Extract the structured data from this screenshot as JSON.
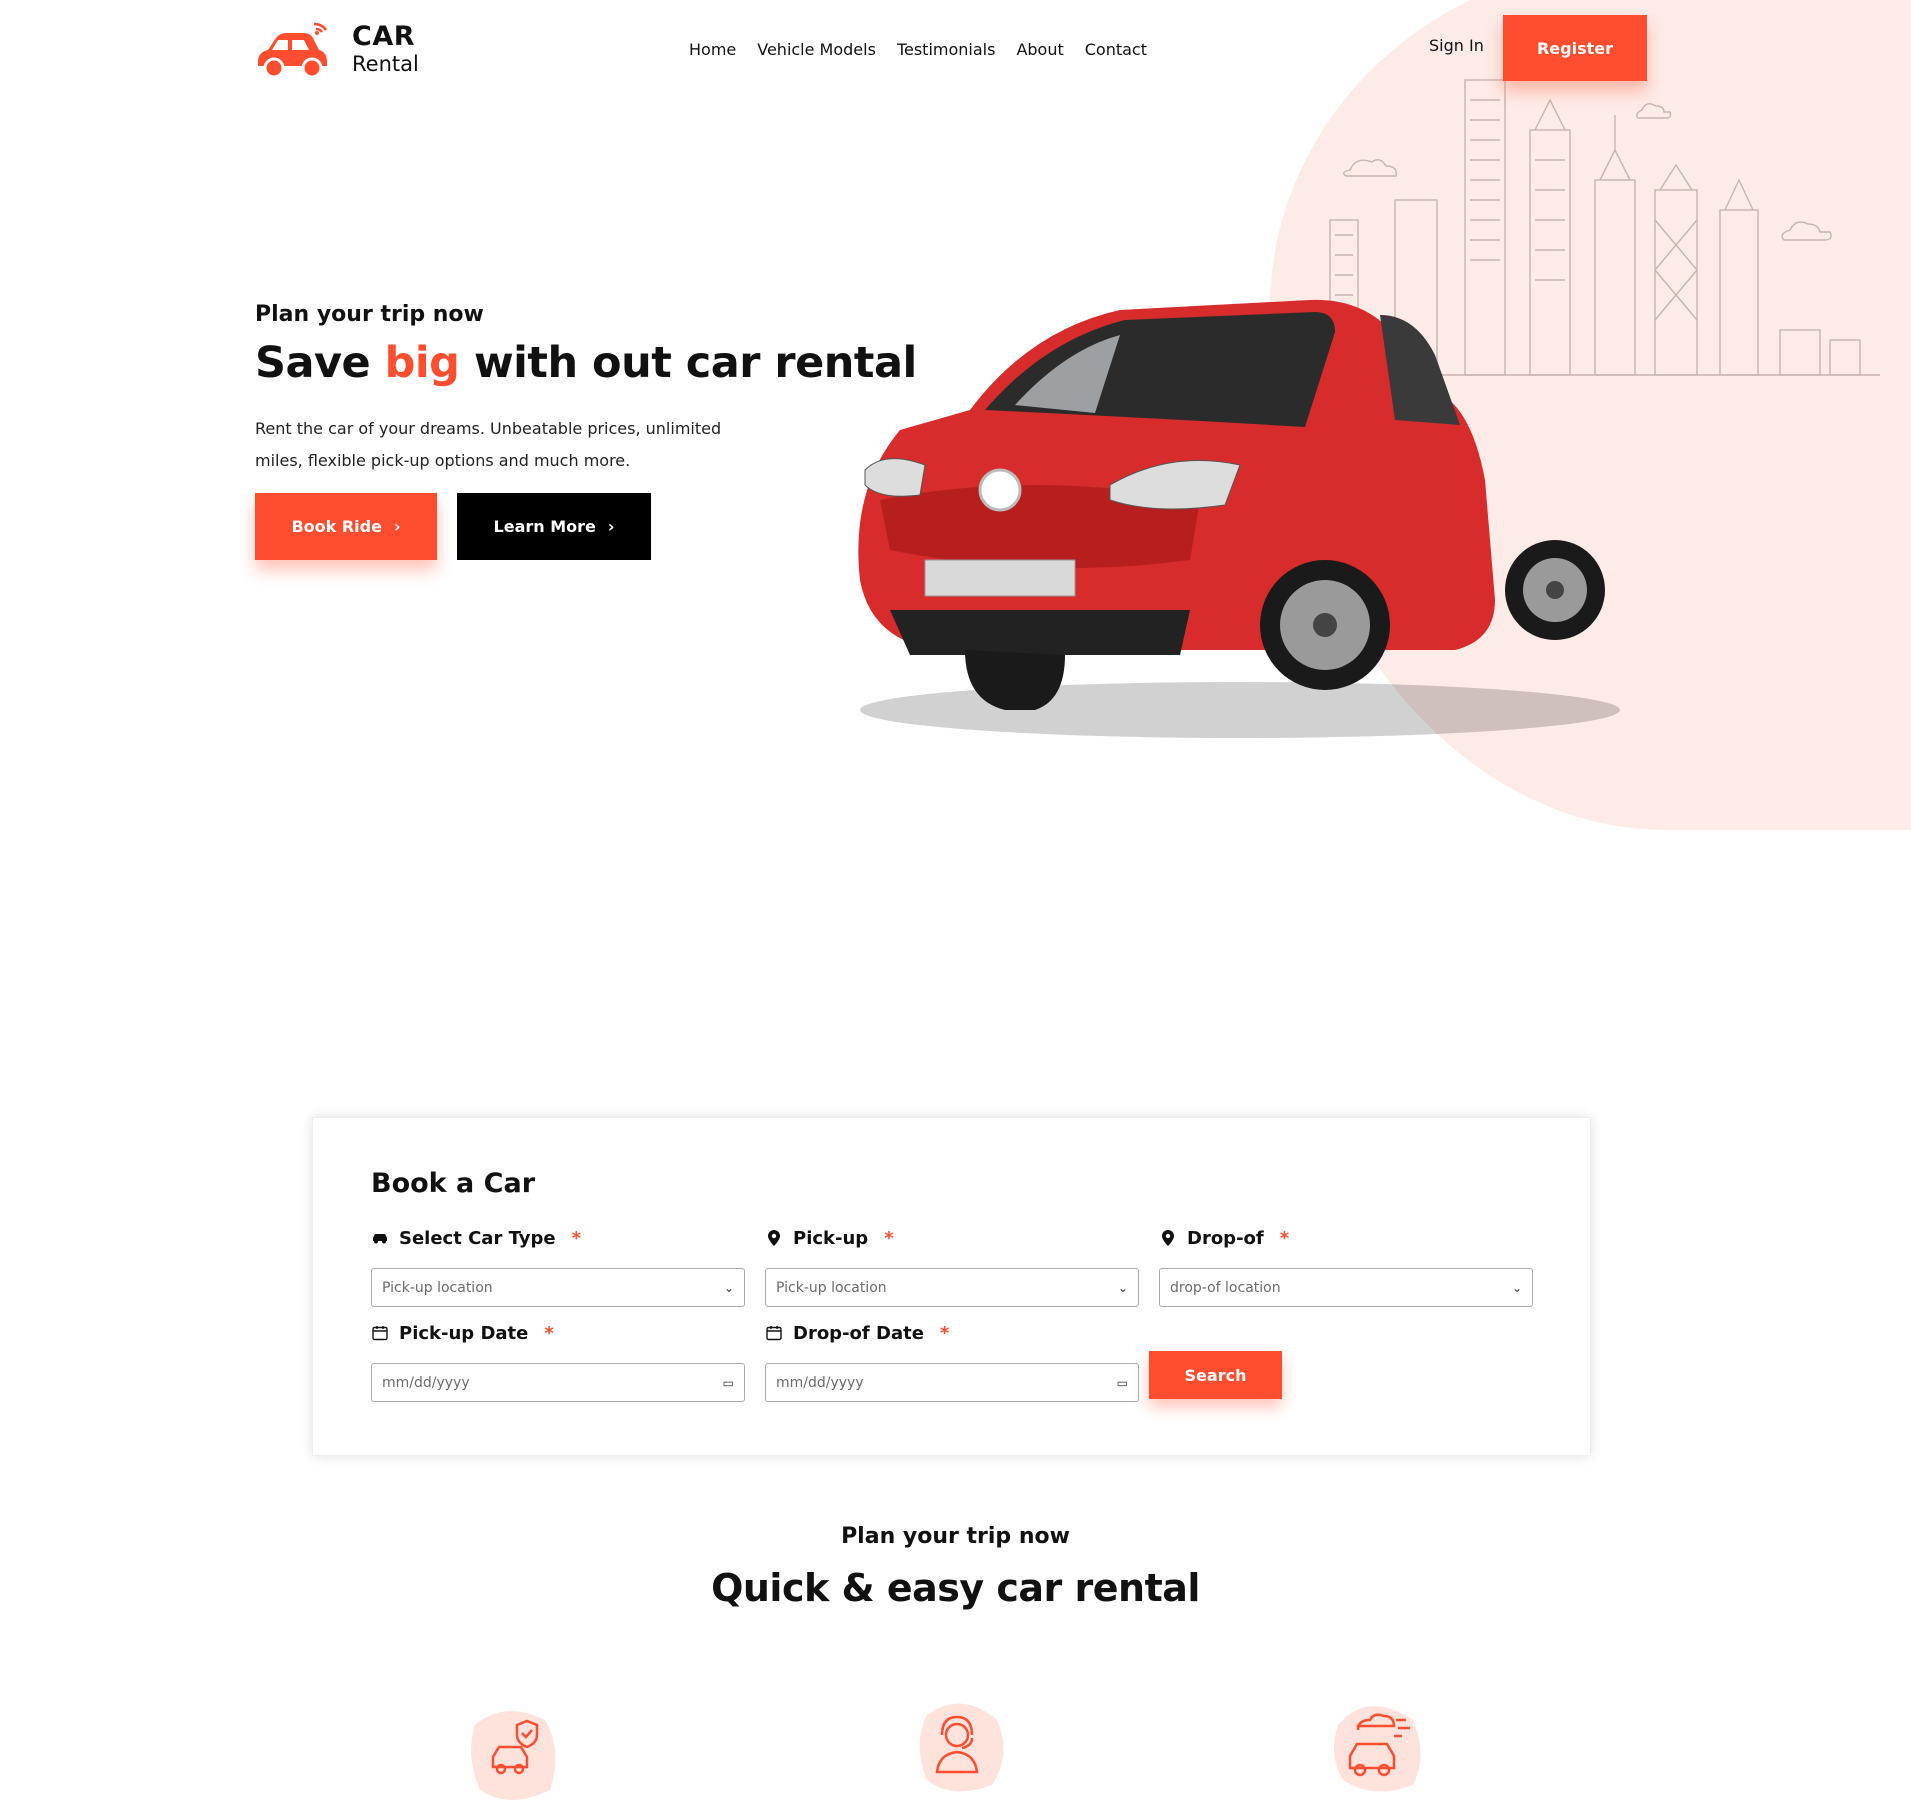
{
  "brand": {
    "line1": "CAR",
    "line2": "Rental",
    "accent_color": "#ff4d30"
  },
  "nav": {
    "items": [
      "Home",
      "Vehicle Models",
      "Testimonials",
      "About",
      "Contact"
    ]
  },
  "auth": {
    "sign_in": "Sign In",
    "register": "Register"
  },
  "hero": {
    "kicker": "Plan your trip now",
    "title_before": "Save ",
    "title_accent": "big",
    "title_after": " with out car rental",
    "description": "Rent the car of your dreams. Unbeatable prices, unlimited miles, flexible pick-up options and much more.",
    "book_ride": "Book Ride",
    "learn_more": "Learn More"
  },
  "booking": {
    "title": "Book a Car",
    "car_type": {
      "label": "Select Car Type",
      "required": "*",
      "value": "Pick-up location",
      "icon": "car-icon"
    },
    "pickup": {
      "label": "Pick-up",
      "required": "*",
      "value": "Pick-up location",
      "icon": "location-pin-icon"
    },
    "dropoff": {
      "label": "Drop-of",
      "required": "*",
      "value": "drop-of location",
      "icon": "location-pin-icon"
    },
    "pickup_date": {
      "label": "Pick-up Date",
      "required": "*",
      "placeholder": "mm/dd/yyyy",
      "icon": "calendar-icon"
    },
    "dropoff_date": {
      "label": "Drop-of Date",
      "required": "*",
      "placeholder": "mm/dd/yyyy",
      "icon": "calendar-icon"
    },
    "search": "Search"
  },
  "plan": {
    "kicker": "Plan your trip now",
    "title": "Quick & easy car rental"
  },
  "features": {
    "icons": [
      "car-shield-icon",
      "support-agent-icon",
      "car-fast-icon"
    ]
  }
}
